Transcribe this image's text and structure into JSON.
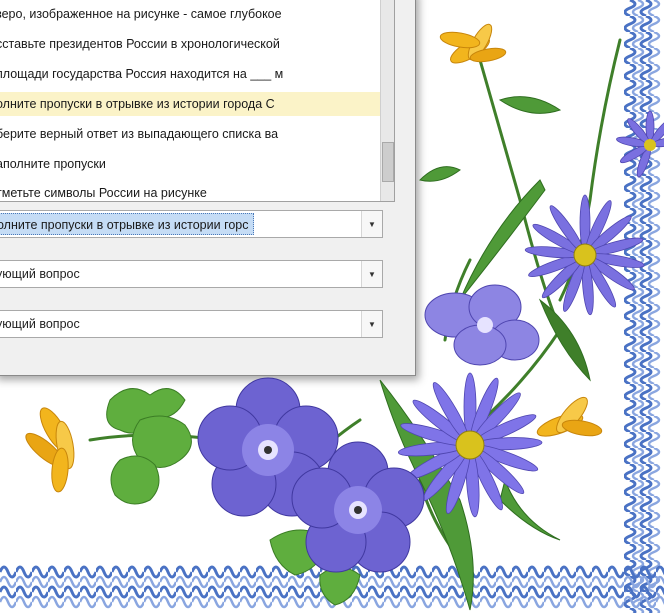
{
  "question_list": {
    "items": [
      "зеро, изображенное на рисунке - самое глубокое",
      "сставьте президентов России в хронологической",
      "площади государства Россия находится на ___ м",
      "олните пропуски в отрывке из истории города С",
      "берите верный ответ из выпадающего списка ва",
      "аполните пропуски",
      "тметьте символы России на рисунке"
    ],
    "highlighted_index": 3
  },
  "combos": {
    "current": "олните пропуски в отрывке из истории горс",
    "next_1": "ующий вопрос",
    "next_2": "ующий вопрос"
  },
  "colors": {
    "border_wave": "#4a72c4",
    "highlight_row": "#fbf3c8",
    "selection": "#c5dcf5",
    "flower_purple": "#6d63d1",
    "leaf_green": "#3f8a2e",
    "flower_yellow": "#f2b51d"
  },
  "icons": [
    "chevron-down-icon"
  ]
}
